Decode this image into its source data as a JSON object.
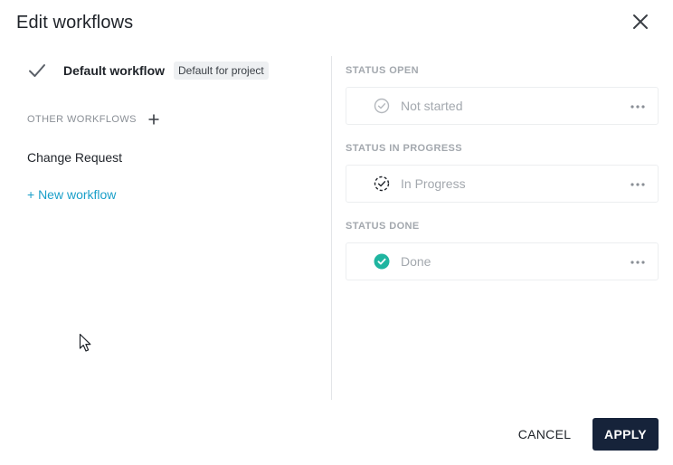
{
  "dialog": {
    "title": "Edit workflows",
    "close_icon": "close-icon"
  },
  "left_panel": {
    "default_workflow": {
      "icon": "checkmark-icon",
      "label": "Default workflow",
      "badge": "Default for project"
    },
    "other_workflows": {
      "header": "OTHER WORKFLOWS",
      "add_icon": "plus-icon",
      "items": [
        {
          "label": "Change Request"
        }
      ]
    },
    "new_workflow_link": "+ New workflow"
  },
  "statuses": [
    {
      "header": "STATUS OPEN",
      "name": "Not started",
      "icon": "circle-check-outline-icon"
    },
    {
      "header": "STATUS IN PROGRESS",
      "name": "In Progress",
      "icon": "circle-check-dashed-icon"
    },
    {
      "header": "STATUS DONE",
      "name": "Done",
      "icon": "circle-check-filled-icon"
    }
  ],
  "footer": {
    "cancel_label": "CANCEL",
    "apply_label": "APPLY"
  },
  "colors": {
    "accent_link": "#1a9fc9",
    "done_green": "#1fb5a0",
    "apply_bg": "#16233a"
  }
}
